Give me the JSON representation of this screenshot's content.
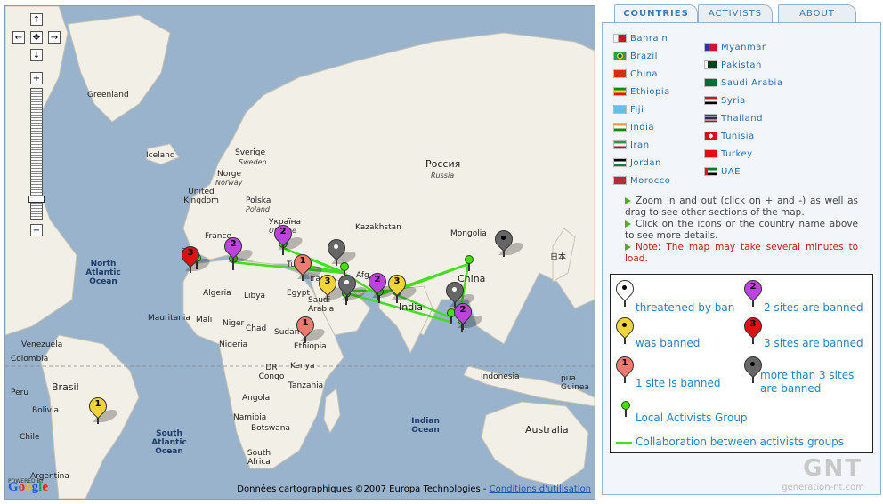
{
  "map": {
    "labels": {
      "greenland": "Greenland",
      "iceland": "Iceland",
      "sverige": "Sverige",
      "sweden": "Sweden",
      "norge": "Norge",
      "norway": "Norway",
      "rossiya": "Россия",
      "russia": "Russia",
      "uk": "United Kingdom",
      "polska": "Polska",
      "poland": "Poland",
      "ukraina": "Україна",
      "ukraine": "Ukraine",
      "france": "France",
      "kazakhstan": "Kazakhstan",
      "mongolia": "Mongolia",
      "north_atlantic": "North Atlantic Ocean",
      "algeria": "Algeria",
      "libya": "Libya",
      "egypt": "Egypt",
      "mauritania": "Mauritania",
      "mali": "Mali",
      "niger": "Niger",
      "chad": "Chad",
      "sudan": "Sudan",
      "saudi": "Saudi Arabia",
      "ethiopia": "Ethiopia",
      "nigeria": "Nigeria",
      "drc": "DR Congo",
      "kenya": "Kenya",
      "tanzania": "Tanzania",
      "angola": "Angola",
      "namibia": "Namibia",
      "botswana": "Botswana",
      "south_africa": "South Africa",
      "south_atlantic": "South Atlantic Ocean",
      "indian_ocean": "Indian Ocean",
      "india": "India",
      "china": "China",
      "japan": "日本",
      "indonesia": "Indonesia",
      "australia": "Australia",
      "venezuela": "Venezuela",
      "colombia": "Colombia",
      "peru": "Peru",
      "brasil": "Brasil",
      "bolivia": "Bolivia",
      "chile": "Chile",
      "argentina": "Argentina",
      "pakistan_short": "Pa",
      "afghanistan_short": "Afg",
      "iran_short": "Ira",
      "spain_short": "ana",
      "turkey_short": "Tu",
      "png_short": "pua\nGuinea"
    },
    "pins": [
      {
        "label": "3",
        "color": "#dd1111"
      },
      {
        "label": "2",
        "color": "#bb44dd"
      },
      {
        "label": "2",
        "color": "#bb44dd"
      },
      {
        "label": "",
        "color": "#666666"
      },
      {
        "label": "1",
        "color": "#f07a70"
      },
      {
        "label": "3",
        "color": "#f2d43a"
      },
      {
        "label": "",
        "color": "#666666"
      },
      {
        "label": "2",
        "color": "#bb44dd"
      },
      {
        "label": "3",
        "color": "#f2d43a"
      },
      {
        "label": "",
        "color": "#666666"
      },
      {
        "label": "",
        "color": "#666666"
      },
      {
        "label": "2",
        "color": "#bb44dd"
      },
      {
        "label": "1",
        "color": "#f07a70"
      },
      {
        "label": "1",
        "color": "#f2d43a"
      }
    ],
    "powered_by": "POWERED BY",
    "google_letters": [
      "G",
      "o",
      "o",
      "g",
      "l",
      "e"
    ],
    "copyright": "Données cartographiques ©2007 Europa Technologies -",
    "terms_link": "Conditions d'utilisation"
  },
  "tabs": [
    "COUNTRIES",
    "ACTIVISTS",
    "ABOUT"
  ],
  "countries_left": [
    "Bahrain",
    "Brazil",
    "China",
    "Ethiopia",
    "Fiji",
    "India",
    "Iran",
    "Jordan",
    "Morocco"
  ],
  "countries_right": [
    "Myanmar",
    "Pakistan",
    "Saudi Arabia",
    "Syria",
    "Thailand",
    "Tunisia",
    "Turkey",
    "UAE"
  ],
  "notes": {
    "line1": "Zoom in and out (click on + and -) as well as drag to see other sections of the map.",
    "line2": "Click on the icons or the country name above to see more details.",
    "line3": "Note: The map may take several minutes to load."
  },
  "legend": {
    "threatened": "threatened by ban",
    "was_banned": "was banned",
    "one_site": "1 site is banned",
    "two_sites": "2 sites are banned",
    "three_sites": "3 sites are banned",
    "more_than_three": "more than 3 sites are banned",
    "local_group": "Local Activists Group",
    "collaboration": "Collaboration between activists groups"
  },
  "watermark": {
    "logo": "GNT",
    "site": "generation-nt.com"
  }
}
